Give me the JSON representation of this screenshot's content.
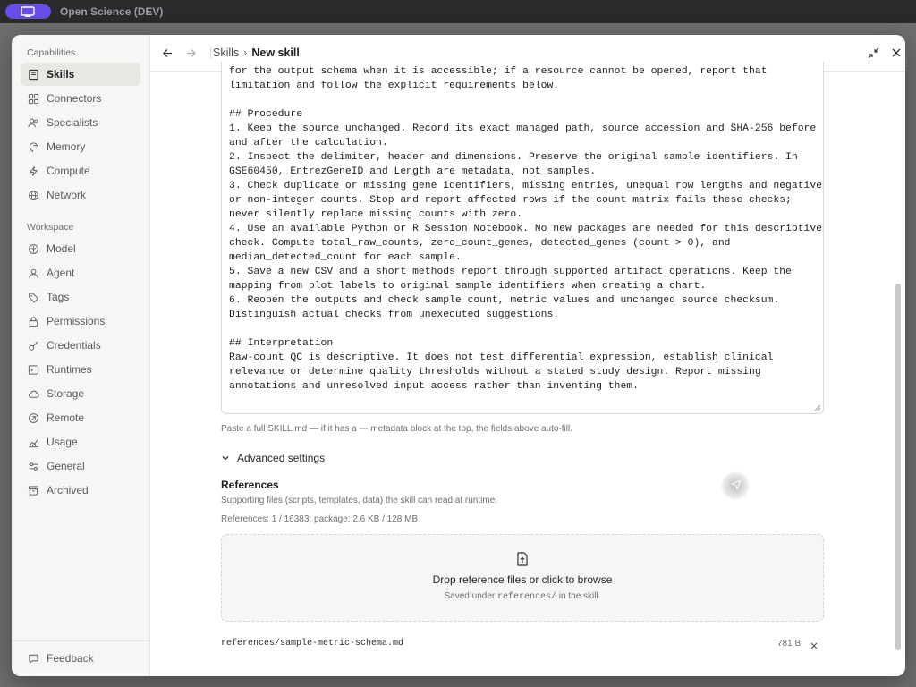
{
  "app": {
    "title": "Open Science (DEV)"
  },
  "sidebar": {
    "capabilities_title": "Capabilities",
    "capabilities": [
      {
        "label": "Skills",
        "icon": "book-icon",
        "active": true
      },
      {
        "label": "Connectors",
        "icon": "grid-icon"
      },
      {
        "label": "Specialists",
        "icon": "users-icon"
      },
      {
        "label": "Memory",
        "icon": "brain-icon"
      },
      {
        "label": "Compute",
        "icon": "bolt-icon"
      },
      {
        "label": "Network",
        "icon": "globe-icon"
      }
    ],
    "workspace_title": "Workspace",
    "workspace": [
      {
        "label": "Model",
        "icon": "model-icon"
      },
      {
        "label": "Agent",
        "icon": "agent-icon"
      },
      {
        "label": "Tags",
        "icon": "tag-icon"
      },
      {
        "label": "Permissions",
        "icon": "lock-icon"
      },
      {
        "label": "Credentials",
        "icon": "key-icon"
      },
      {
        "label": "Runtimes",
        "icon": "terminal-icon"
      },
      {
        "label": "Storage",
        "icon": "cloud-icon"
      },
      {
        "label": "Remote",
        "icon": "remote-icon"
      },
      {
        "label": "Usage",
        "icon": "chart-icon"
      },
      {
        "label": "General",
        "icon": "sliders-icon"
      },
      {
        "label": "Archived",
        "icon": "archive-icon"
      }
    ],
    "feedback": "Feedback"
  },
  "header": {
    "crumb_parent": "Skills",
    "crumb_sep": "›",
    "crumb_current": "New skill"
  },
  "editor": {
    "text": "for the output schema when it is accessible; if a resource cannot be opened, report that\nlimitation and follow the explicit requirements below.\n\n## Procedure\n1. Keep the source unchanged. Record its exact managed path, source accession and SHA-256 before\nand after the calculation.\n2. Inspect the delimiter, header and dimensions. Preserve the original sample identifiers. In\nGSE60450, EntrezGeneID and Length are metadata, not samples.\n3. Check duplicate or missing gene identifiers, missing entries, unequal row lengths and negative\nor non-integer counts. Stop and report affected rows if the count matrix fails these checks;\nnever silently replace missing counts with zero.\n4. Use an available Python or R Session Notebook. No new packages are needed for this descriptive\ncheck. Compute total_raw_counts, zero_count_genes, detected_genes (count > 0), and\nmedian_detected_count for each sample.\n5. Save a new CSV and a short methods report through supported artifact operations. Keep the\nmapping from plot labels to original sample identifiers when creating a chart.\n6. Reopen the outputs and check sample count, metric values and unchanged source checksum.\nDistinguish actual checks from unexecuted suggestions.\n\n## Interpretation\nRaw-count QC is descriptive. It does not test differential expression, establish clinical\nrelevance or determine quality thresholds without a stated study design. Report missing\nannotations and unresolved input access rather than inventing them."
  },
  "hint": "Paste a full SKILL.md — if it has a --- metadata block at the top, the fields above auto-fill.",
  "advanced": {
    "label": "Advanced settings"
  },
  "references": {
    "title": "References",
    "subtitle": "Supporting files (scripts, templates, data) the skill can read at runtime.",
    "count": "References: 1 / 16383; package: 2.6 KB / 128 MB",
    "drop_title": "Drop reference files or click to browse",
    "drop_sub_pre": "Saved under",
    "drop_sub_code": "references/",
    "drop_sub_post": "in the skill.",
    "files": [
      {
        "name": "references/sample-metric-schema.md",
        "size": "781 B"
      }
    ]
  },
  "colors": {
    "accent": "#6a4de8",
    "sidebar_bg": "#f6f6f4",
    "active_item": "#e7e7e4"
  }
}
